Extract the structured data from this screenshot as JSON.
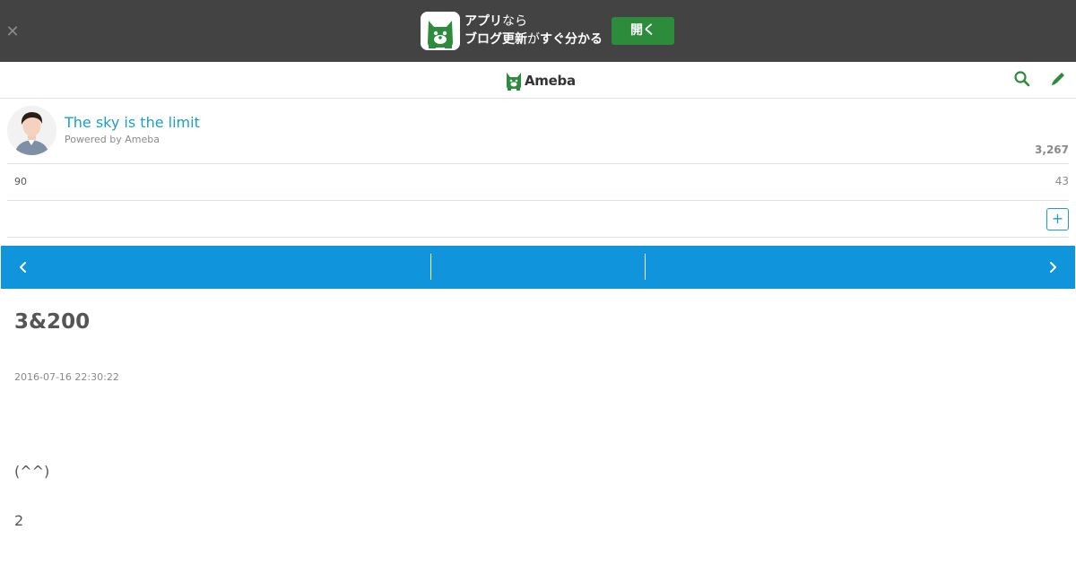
{
  "banner": {
    "close_icon": "close-icon",
    "line1_bold": "アプリ",
    "line1_light": "なら",
    "line2_bold_a": "ブログ更新",
    "line2_light": "が",
    "line2_bold_b": "すぐ分かる",
    "open_label": "開く",
    "open_color": "#2d8c3c"
  },
  "header": {
    "logo_text": "Ameba",
    "brand_color": "#2d8c3c",
    "search_icon": "search-icon",
    "edit_icon": "pencil-icon"
  },
  "profile": {
    "blog_title": "The sky is the limit",
    "powered_by": "Powered by Ameba",
    "reader_count": "3,267"
  },
  "stats": {
    "left": "90",
    "right": "43"
  },
  "follow": {
    "label": "+"
  },
  "navbar": {
    "color": "#1094db",
    "prev_icon": "chevron-left-icon",
    "next_icon": "chevron-right-icon"
  },
  "article": {
    "title": "3&200",
    "date": "2016-07-16 22:30:22",
    "line1": "(^^)",
    "line2": "2"
  }
}
